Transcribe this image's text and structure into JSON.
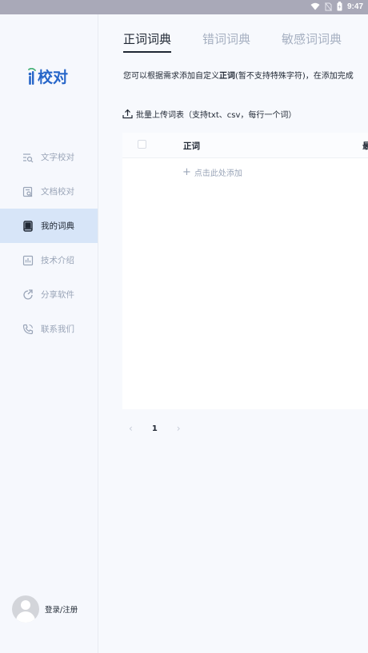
{
  "status_bar": {
    "time": "9:47"
  },
  "sidebar": {
    "logo_text": "校对",
    "items": [
      {
        "label": "文字校对",
        "icon": "text-search-icon",
        "active": false
      },
      {
        "label": "文档校对",
        "icon": "document-search-icon",
        "active": false
      },
      {
        "label": "我的词典",
        "icon": "book-icon",
        "active": true
      },
      {
        "label": "技术介绍",
        "icon": "chart-icon",
        "active": false
      },
      {
        "label": "分享软件",
        "icon": "share-icon",
        "active": false
      },
      {
        "label": "联系我们",
        "icon": "phone-icon",
        "active": false
      }
    ],
    "account_label": "登录/注册"
  },
  "main": {
    "tabs": [
      {
        "label": "正词词典",
        "active": true
      },
      {
        "label": "错词词典",
        "active": false
      },
      {
        "label": "敏感词词典",
        "active": false
      }
    ],
    "description": {
      "prefix": "您可以根据需求添加自定义",
      "bold": "正词",
      "suffix": "(暂不支持特殊字符)，在添加完成"
    },
    "upload_label": "批量上传词表（支持txt、csv，每行一个词）",
    "table": {
      "columns": [
        "正词",
        "最"
      ],
      "add_label": "点击此处添加"
    },
    "pagination": {
      "current": "1"
    }
  },
  "colors": {
    "accent": "#2766c9",
    "active_bg": "#d7e5f8",
    "muted": "#9aa5b8"
  }
}
